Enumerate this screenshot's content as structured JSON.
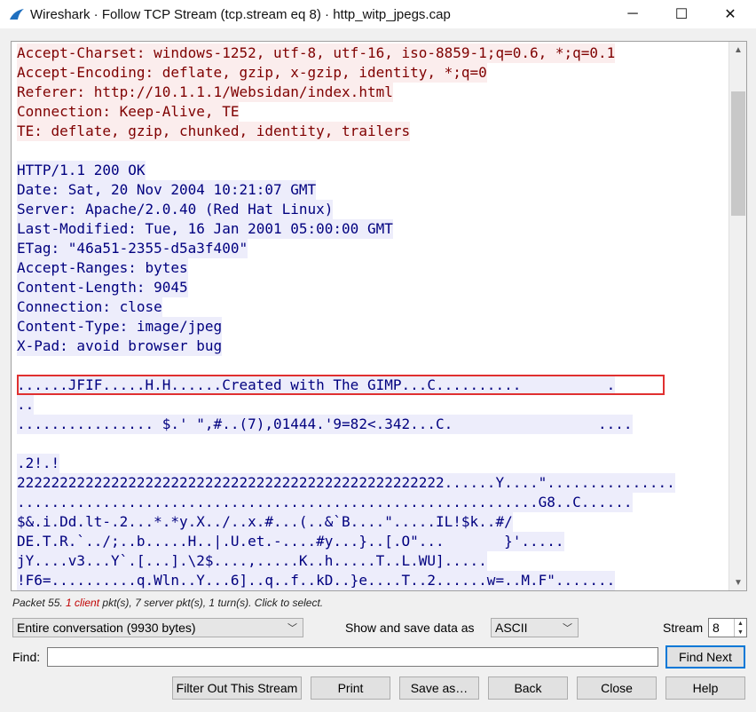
{
  "window": {
    "title": "Wireshark · Follow TCP Stream (tcp.stream eq 8) · http_witp_jpegs.cap",
    "icon": "wireshark-fin-icon",
    "controls": {
      "minimize": "─",
      "maximize": "☐",
      "close": "✕"
    }
  },
  "colors": {
    "client_bg": "#fbeded",
    "client_fg": "#7f0000",
    "server_bg": "#ededfb",
    "server_fg": "#00007f",
    "selection_box": "#e03030"
  },
  "stream_lines": [
    {
      "side": "client",
      "text": "Accept-Charset: windows-1252, utf-8, utf-16, iso-8859-1;q=0.6, *;q=0.1"
    },
    {
      "side": "client",
      "text": "Accept-Encoding: deflate, gzip, x-gzip, identity, *;q=0"
    },
    {
      "side": "client",
      "text": "Referer: http://10.1.1.1/Websidan/index.html"
    },
    {
      "side": "client",
      "text": "Connection: Keep-Alive, TE"
    },
    {
      "side": "client",
      "text": "TE: deflate, gzip, chunked, identity, trailers"
    },
    {
      "side": "blank",
      "text": ""
    },
    {
      "side": "server",
      "text": "HTTP/1.1 200 OK"
    },
    {
      "side": "server",
      "text": "Date: Sat, 20 Nov 2004 10:21:07 GMT"
    },
    {
      "side": "server",
      "text": "Server: Apache/2.0.40 (Red Hat Linux)"
    },
    {
      "side": "server",
      "text": "Last-Modified: Tue, 16 Jan 2001 05:00:00 GMT"
    },
    {
      "side": "server",
      "text": "ETag: \"46a51-2355-d5a3f400\""
    },
    {
      "side": "server",
      "text": "Accept-Ranges: bytes"
    },
    {
      "side": "server",
      "text": "Content-Length: 9045"
    },
    {
      "side": "server",
      "text": "Connection: close"
    },
    {
      "side": "server",
      "text": "Content-Type: image/jpeg"
    },
    {
      "side": "server",
      "text": "X-Pad: avoid browser bug"
    },
    {
      "side": "blank",
      "text": ""
    },
    {
      "side": "server",
      "text": "......JFIF.....H.H......Created with The GIMP...C..........          ."
    },
    {
      "side": "server",
      "text": ".."
    },
    {
      "side": "server",
      "text": "................ $.' \",#..(7),01444.'9=82<.342...C.                 ...."
    },
    {
      "side": "blank",
      "text": ""
    },
    {
      "side": "server",
      "text": ".2!.!"
    },
    {
      "side": "server",
      "text": "22222222222222222222222222222222222222222222222222......Y....\"..............."
    },
    {
      "side": "server",
      "text": ".............................................................G8..C......"
    },
    {
      "side": "server",
      "text": "$&.i.Dd.lt-.2...*.*y.X../..x.#...(..&`B....\".....IL!$k..#/"
    },
    {
      "side": "server",
      "text": "DE.T.R.`../;..b.....H..|.U.et.-....#y...}..[.O\"...       }'....."
    },
    {
      "side": "server",
      "text": "jY....v3...Y`.[...].\\2$....,.....K..h.....T..L.WU]....."
    },
    {
      "side": "server",
      "text": "!F6=..........q.Wln..Y...6]..q..f..kD..}e....T..2......w=..M.F\"......."
    }
  ],
  "status": {
    "prefix": "Packet 55. ",
    "client_count": "1 client",
    "suffix": " pkt(s), 7 server pkt(s), 1 turn(s). Click to select."
  },
  "controls": {
    "conversation_select": "Entire conversation (9930 bytes)",
    "show_save_label": "Show and save data as",
    "format_select": "ASCII",
    "stream_label": "Stream",
    "stream_value": "8",
    "find_label": "Find:",
    "find_value": "",
    "find_next": "Find Next"
  },
  "buttons": {
    "filter_out": "Filter Out This Stream",
    "print": "Print",
    "save_as": "Save as…",
    "back": "Back",
    "close": "Close",
    "help": "Help"
  }
}
